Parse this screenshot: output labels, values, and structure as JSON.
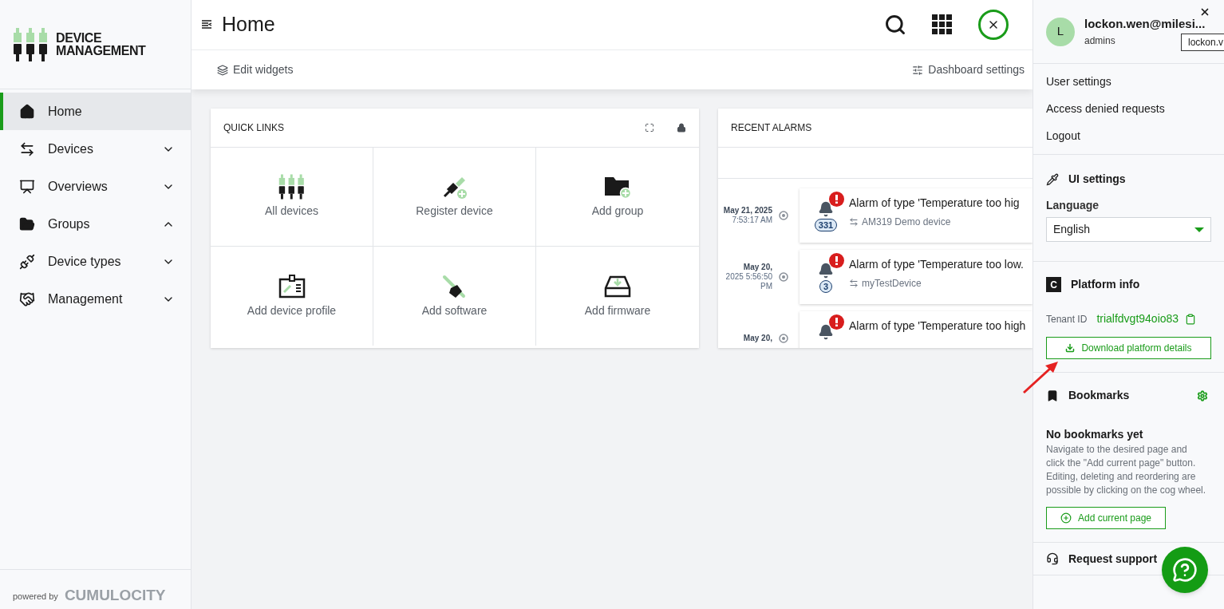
{
  "sidebar": {
    "logo_lines": [
      "DEVICE",
      "MANAGEMENT"
    ],
    "nav": [
      {
        "kind": "home",
        "label": "Home",
        "selected": true
      },
      {
        "kind": "devices",
        "label": "Devices",
        "selected": false,
        "expanded": false
      },
      {
        "kind": "overviews",
        "label": "Overviews",
        "selected": false,
        "expanded": false
      },
      {
        "kind": "groups",
        "label": "Groups",
        "selected": false,
        "expanded": true
      },
      {
        "kind": "device-types",
        "label": "Device types",
        "selected": false,
        "expanded": false
      },
      {
        "kind": "management",
        "label": "Management",
        "selected": false,
        "expanded": false
      }
    ],
    "powered_by": "powered by",
    "brand": "CUMULOCITY"
  },
  "header": {
    "title": "Home"
  },
  "toolbar": {
    "edit_widgets": "Edit widgets",
    "dashboard_settings": "Dashboard settings"
  },
  "quick_links": {
    "title": "QUICK LINKS",
    "links": [
      {
        "kind": "all-devices",
        "label": "All devices"
      },
      {
        "kind": "register-device",
        "label": "Register device"
      },
      {
        "kind": "add-group",
        "label": "Add group"
      },
      {
        "kind": "add-device-profile",
        "label": "Add device profile"
      },
      {
        "kind": "add-software",
        "label": "Add software"
      },
      {
        "kind": "add-firmware",
        "label": "Add firmware"
      }
    ]
  },
  "recent_alarms": {
    "title": "RECENT ALARMS",
    "alarms": [
      {
        "date": "May 21, 2025",
        "time": "7:53:17 AM",
        "title": "Alarm of type 'Temperature too hig",
        "device": "AM319 Demo device",
        "count": "331"
      },
      {
        "date": "May 20,",
        "time": "2025 5:56:50 PM",
        "title": "Alarm of type 'Temperature too low.",
        "device": "myTestDevice",
        "count": "3"
      },
      {
        "date": "May 20,",
        "title": "Alarm of type 'Temperature too high"
      }
    ]
  },
  "user_panel": {
    "avatar": "L",
    "email": "lockon.wen@milesi...",
    "role": "admins",
    "tooltip": "lockon.v",
    "menu": [
      "User settings",
      "Access denied requests",
      "Logout"
    ],
    "ui_settings": {
      "title": "UI settings",
      "language_label": "Language",
      "language": "English"
    },
    "platform_info": {
      "title": "Platform info",
      "logo": "C",
      "tenant_label": "Tenant ID",
      "tenant_id": "trialfdvgt94oio83",
      "download": "Download platform details"
    },
    "bookmarks": {
      "title": "Bookmarks",
      "empty_title": "No bookmarks yet",
      "empty_text": "Navigate to the desired page and click the \"Add current page\" button. Editing, deleting and reordering are possible by clicking on the cog wheel.",
      "add": "Add current page"
    },
    "request_support": "Request support"
  }
}
